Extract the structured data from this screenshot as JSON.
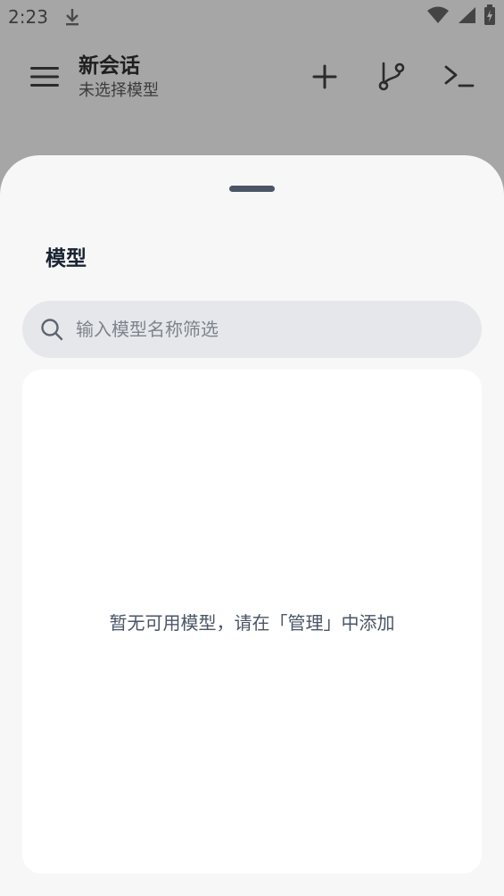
{
  "status_bar": {
    "time": "2:23",
    "icons": [
      "download-icon",
      "wifi-icon",
      "signal-icon",
      "battery-icon"
    ]
  },
  "app_bar": {
    "title": "新会话",
    "subtitle": "未选择模型",
    "icons": [
      "menu-icon",
      "plus-icon",
      "branch-icon",
      "terminal-icon"
    ]
  },
  "sheet": {
    "title": "模型",
    "search": {
      "placeholder": "输入模型名称筛选",
      "value": ""
    },
    "empty_message": "暂无可用模型，请在「管理」中添加"
  },
  "colors": {
    "scrim": "#a6a6a6",
    "sheet_bg": "#f7f7f8",
    "search_bg": "#e6e7ea",
    "list_bg": "#ffffff",
    "text_dark": "#1b2433",
    "text_muted": "#4a5566"
  }
}
